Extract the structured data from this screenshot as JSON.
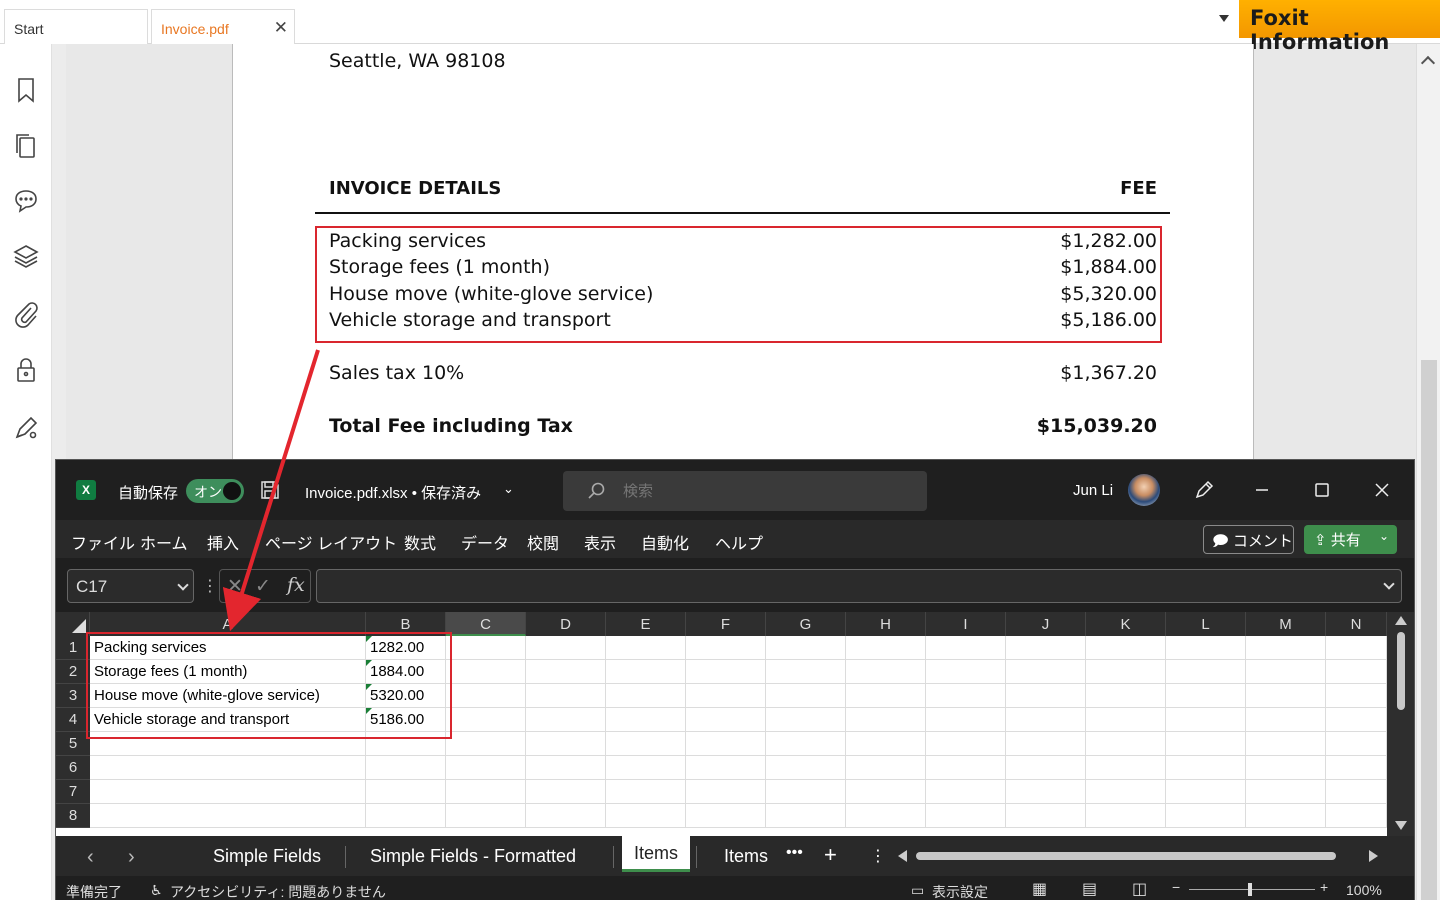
{
  "foxit": {
    "tabs": [
      {
        "label": "Start"
      },
      {
        "label": "Invoice.pdf"
      }
    ],
    "badge": "Foxit Information",
    "sidebar_icons": [
      "bookmark-icon",
      "pages-icon",
      "comment-icon",
      "layers-icon",
      "attachment-icon",
      "security-icon",
      "sign-icon"
    ]
  },
  "pdf": {
    "address_line": "Seattle, WA 98108",
    "details_header": "INVOICE DETAILS",
    "fee_header": "FEE",
    "items": [
      {
        "name": "Packing services",
        "fee": "$1,282.00"
      },
      {
        "name": "Storage fees (1 month)",
        "fee": "$1,884.00"
      },
      {
        "name": "House move (white-glove service)",
        "fee": "$5,320.00"
      },
      {
        "name": "Vehicle storage and transport",
        "fee": "$5,186.00"
      }
    ],
    "sales_tax_label": "Sales tax 10%",
    "sales_tax_value": "$1,367.20",
    "total_label": "Total Fee including Tax",
    "total_value": "$15,039.20"
  },
  "excel": {
    "autosave_label": "自動保存",
    "autosave_state": "オン",
    "file_title": "Invoice.pdf.xlsx • 保存済み",
    "search_placeholder": "検索",
    "user_name": "Jun Li",
    "menu": [
      "ファイル",
      "ホーム",
      "挿入",
      "ページ レイアウト",
      "数式",
      "データ",
      "校閲",
      "表示",
      "自動化",
      "ヘルプ"
    ],
    "comment_label": "コメント",
    "share_label": "共有",
    "name_box": "C17",
    "fx_label": "fx",
    "columns": [
      "A",
      "B",
      "C",
      "D",
      "E",
      "F",
      "G",
      "H",
      "I",
      "J",
      "K",
      "L",
      "M",
      "N"
    ],
    "rows": [
      {
        "num": "1",
        "a": "Packing services",
        "b": "1282.00"
      },
      {
        "num": "2",
        "a": "Storage fees (1 month)",
        "b": "1884.00"
      },
      {
        "num": "3",
        "a": "House move (white-glove service)",
        "b": "5320.00"
      },
      {
        "num": "4",
        "a": "Vehicle storage and transport",
        "b": "5186.00"
      },
      {
        "num": "5",
        "a": "",
        "b": ""
      },
      {
        "num": "6",
        "a": "",
        "b": ""
      },
      {
        "num": "7",
        "a": "",
        "b": ""
      },
      {
        "num": "8",
        "a": "",
        "b": ""
      }
    ],
    "sheet_tabs": [
      "Simple Fields",
      "Simple Fields - Formatted",
      "Items",
      "Items"
    ],
    "status_ready": "準備完了",
    "status_accessibility": "アクセシビリティ: 問題ありません",
    "display_settings": "表示設定",
    "zoom": "100%",
    "colors": {
      "accent_green": "#3e8e4c",
      "highlight_red": "#d9262e"
    }
  }
}
